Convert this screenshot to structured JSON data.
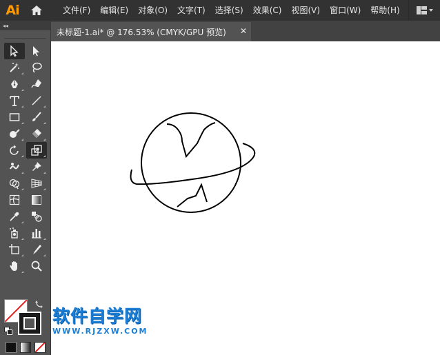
{
  "app": {
    "logo": "Ai"
  },
  "menu": [
    "文件(F)",
    "编辑(E)",
    "对象(O)",
    "文字(T)",
    "选择(S)",
    "效果(C)",
    "视图(V)",
    "窗口(W)",
    "帮助(H)"
  ],
  "tabs": {
    "collapse": "◂◂",
    "document_title": "未标题-1.ai* @ 176.53% (CMYK/GPU 预览)",
    "close": "✕"
  },
  "tools": [
    [
      "selection-tool",
      "direct-selection-tool"
    ],
    [
      "magic-wand-tool",
      "lasso-tool"
    ],
    [
      "pen-tool",
      "curvature-tool"
    ],
    [
      "type-tool",
      "line-segment-tool"
    ],
    [
      "rectangle-tool",
      "paintbrush-tool"
    ],
    [
      "shaper-tool",
      "eraser-tool"
    ],
    [
      "rotate-tool",
      "scale-tool"
    ],
    [
      "warp-tool",
      "puppet-warp-tool"
    ],
    [
      "shape-builder-tool",
      "perspective-grid-tool"
    ],
    [
      "mesh-tool",
      "gradient-tool"
    ],
    [
      "eyedropper-tool",
      "blend-tool"
    ],
    [
      "symbol-sprayer-tool",
      "column-graph-tool"
    ],
    [
      "artboard-tool",
      "slice-tool"
    ],
    [
      "hand-tool",
      "zoom-tool"
    ]
  ],
  "watermark": {
    "title": "软件自学网",
    "url": "WWW.RJZXW.COM"
  },
  "colors": {
    "accent": "#ff9a00",
    "watermark": "#1a7ed6",
    "panel": "#535353",
    "menubar": "#323232"
  }
}
